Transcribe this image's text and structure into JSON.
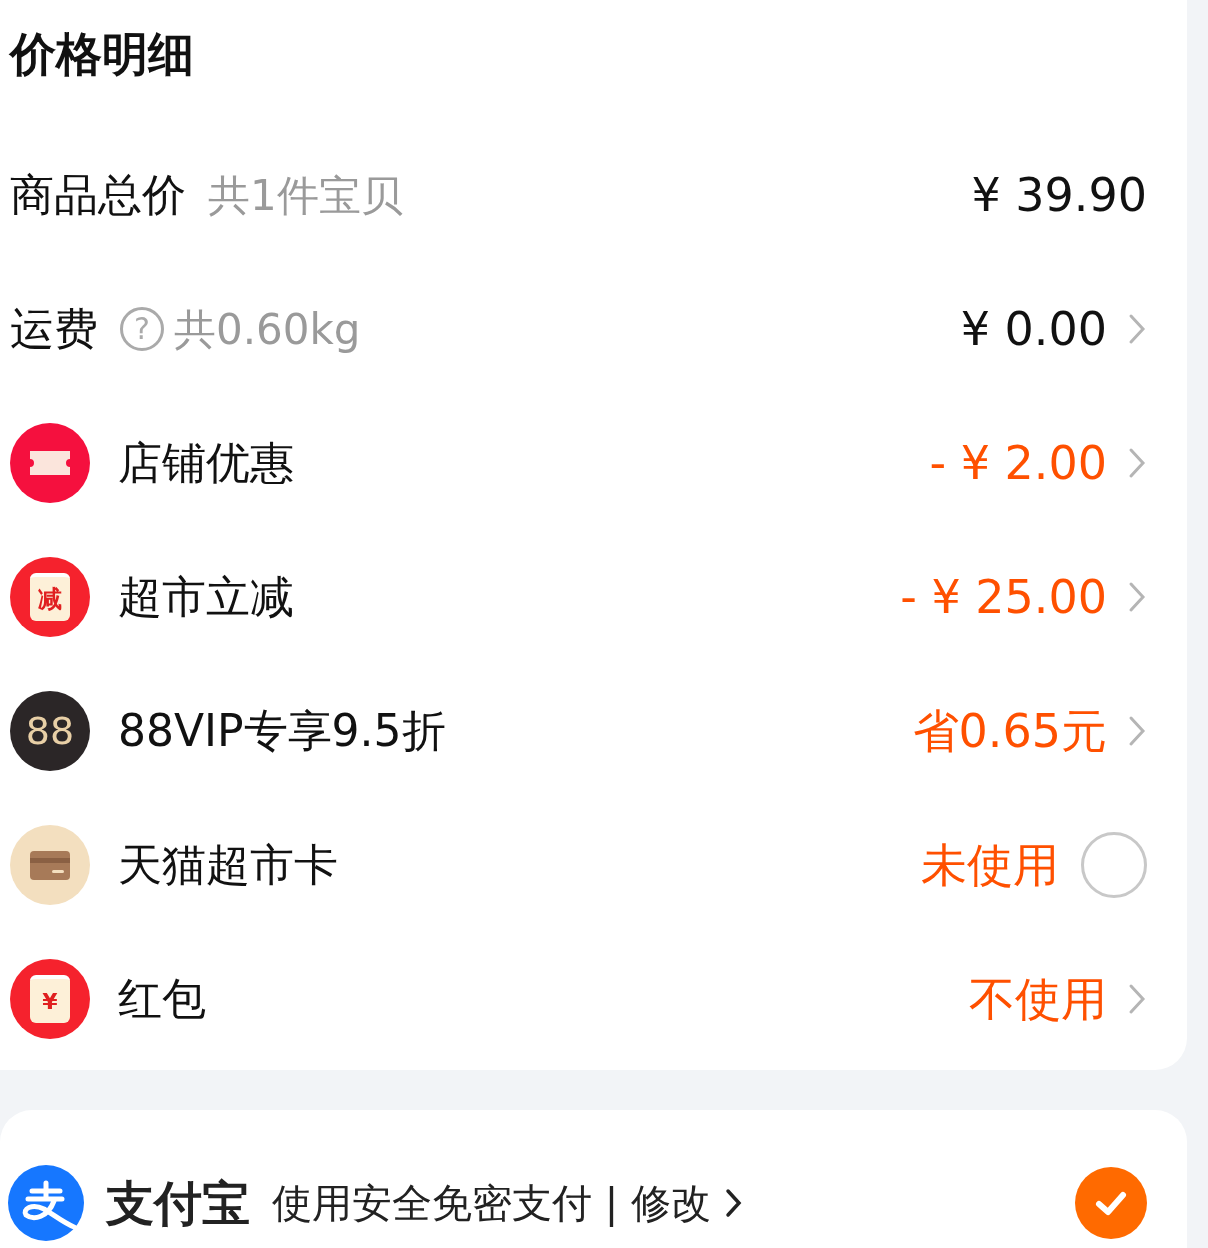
{
  "price_detail": {
    "title": "价格明细",
    "rows": [
      {
        "kind": "plain",
        "label": "商品总价",
        "note": "共1件宝贝",
        "value": "¥ 39.90",
        "accent": false,
        "chevron": false
      },
      {
        "kind": "plain",
        "label": "运费",
        "help": "?",
        "note": "共0.60kg",
        "value": "¥ 0.00",
        "accent": false,
        "chevron": true
      },
      {
        "kind": "benefit",
        "label": "店铺优惠",
        "value": "- ¥ 2.00",
        "accent": true,
        "chevron": true
      },
      {
        "kind": "benefit",
        "label": "超市立减",
        "badge": "减",
        "value": "- ¥ 25.00",
        "accent": true,
        "chevron": true
      },
      {
        "kind": "benefit",
        "label": "88VIP专享9.5折",
        "badge": "88",
        "value": "省0.65元",
        "accent": true,
        "chevron": true
      },
      {
        "kind": "toggle",
        "label": "天猫超市卡",
        "value": "未使用",
        "accent": true,
        "checked": false
      },
      {
        "kind": "benefit",
        "label": "红包",
        "badge": "¥",
        "value": "不使用",
        "accent": true,
        "chevron": true
      }
    ]
  },
  "payment": {
    "name": "支付宝",
    "description": "使用安全免密支付 | 修改",
    "chevron": true,
    "selected": true
  }
}
